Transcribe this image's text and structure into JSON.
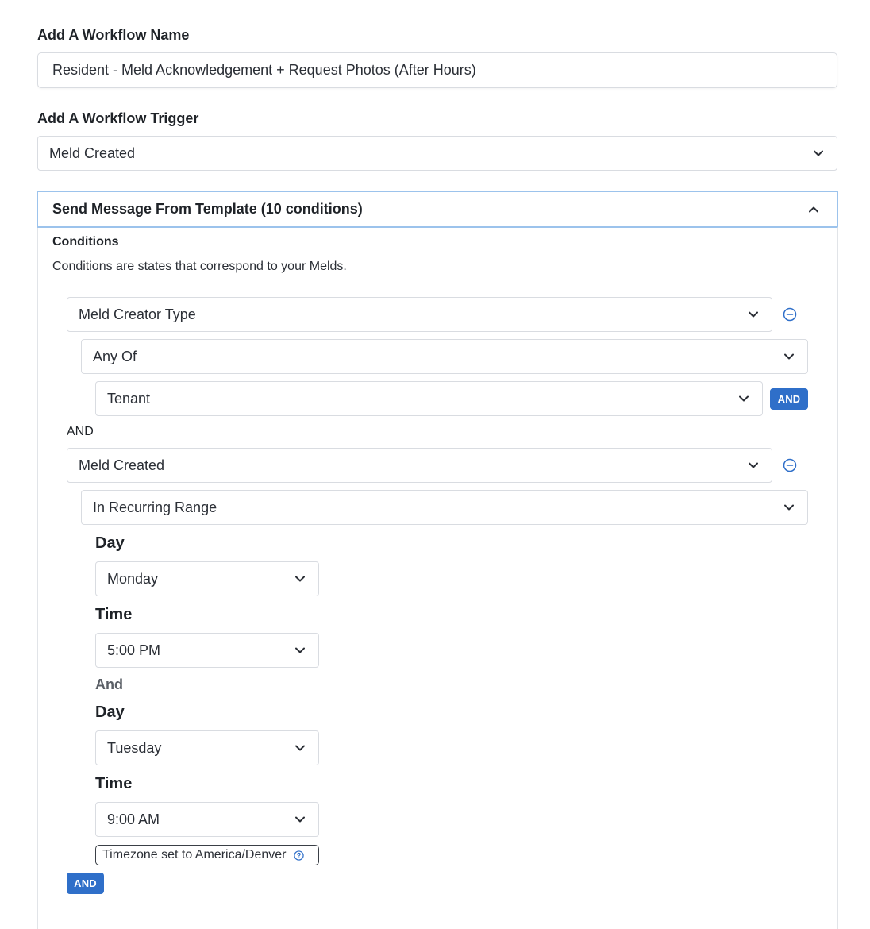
{
  "workflow_name": {
    "label": "Add A Workflow Name",
    "value": "Resident - Meld Acknowledgement + Request Photos (After Hours)"
  },
  "workflow_trigger": {
    "label": "Add A Workflow Trigger",
    "value": "Meld Created"
  },
  "action_section": {
    "title": "Send Message From Template (10 conditions)",
    "conditions_heading": "Conditions",
    "conditions_description": "Conditions are states that correspond to your Melds."
  },
  "condition_1": {
    "field": "Meld Creator Type",
    "operator": "Any Of",
    "value": "Tenant",
    "and_label": "AND"
  },
  "joiner_1": "AND",
  "condition_2": {
    "field": "Meld Created",
    "operator": "In Recurring Range",
    "start_day_label": "Day",
    "start_day": "Monday",
    "start_time_label": "Time",
    "start_time": "5:00 PM",
    "and_text": "And",
    "end_day_label": "Day",
    "end_day": "Tuesday",
    "end_time_label": "Time",
    "end_time": "9:00 AM",
    "timezone_note": "Timezone set to America/Denver",
    "and_label": "AND"
  },
  "colors": {
    "accent_blue": "#2f6fc9",
    "focus_border": "#9cc3ec"
  }
}
